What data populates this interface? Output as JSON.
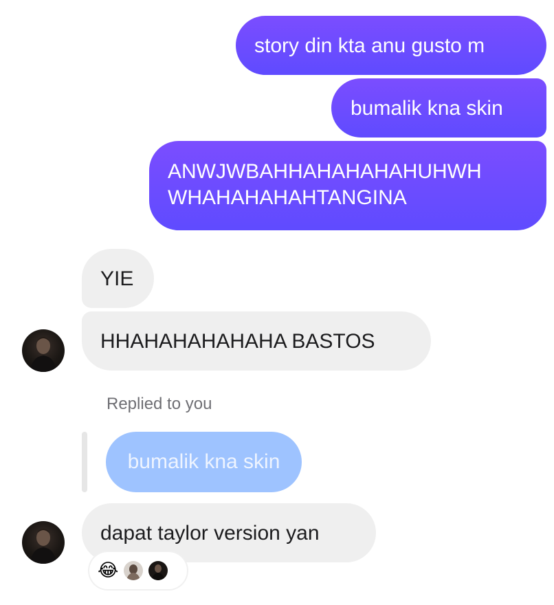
{
  "messages": {
    "sent": [
      {
        "text": "story din kta anu gusto m"
      },
      {
        "text": "bumalik kna skin"
      },
      {
        "line1": "ANWJWBAHHAHAHAHAHUHWH",
        "line2": "WHAHAHAHAHTANGINA"
      }
    ],
    "received": [
      {
        "text": "YIE"
      },
      {
        "text": "HHAHAHAHAHAHA BASTOS"
      },
      {
        "text": "dapat taylor version yan"
      }
    ]
  },
  "reply": {
    "label": "Replied to you",
    "quoted_text": "bumalik kna skin"
  },
  "reactions": {
    "emoji": "😂",
    "reactor_avatars": [
      "reactor-avatar-1",
      "reactor-avatar-2"
    ]
  },
  "colors": {
    "sent_bubble": "#6d4cff",
    "received_bubble": "#efefef",
    "quoted_bubble": "#9ec3ff"
  }
}
